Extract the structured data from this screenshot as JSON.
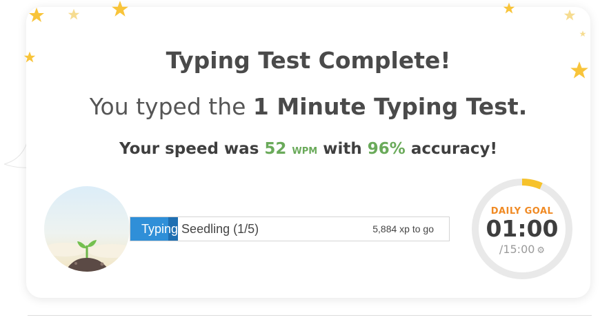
{
  "result": {
    "title": "Typing Test Complete!",
    "line2_prefix": "You typed the ",
    "test_name": "1 Minute Typing Test.",
    "speed_prefix": "Your speed was ",
    "speed_value": "52",
    "speed_unit": "WPM",
    "speed_mid": " with ",
    "accuracy": "96%",
    "speed_suffix": " accuracy!"
  },
  "progress": {
    "typed_part": "Typing",
    "label": "Typing Seedling (1/5)",
    "xp_to_go": "5,884 xp to go",
    "fill_fraction": 0.15,
    "fill_color": "#2f8fd8"
  },
  "daily_goal": {
    "label": "DAILY GOAL",
    "time": "01:00",
    "total": "/15:00",
    "gear_icon": "gear-icon",
    "progress_fraction": 0.0667,
    "arc_color": "#f6c22b"
  },
  "colors": {
    "accent_green": "#6aaa5a",
    "accent_orange": "#f08a24",
    "star_yellow": "#f8c43a"
  },
  "icons": {
    "avatar": "seedling-avatar-icon",
    "stars": "star-icon"
  }
}
